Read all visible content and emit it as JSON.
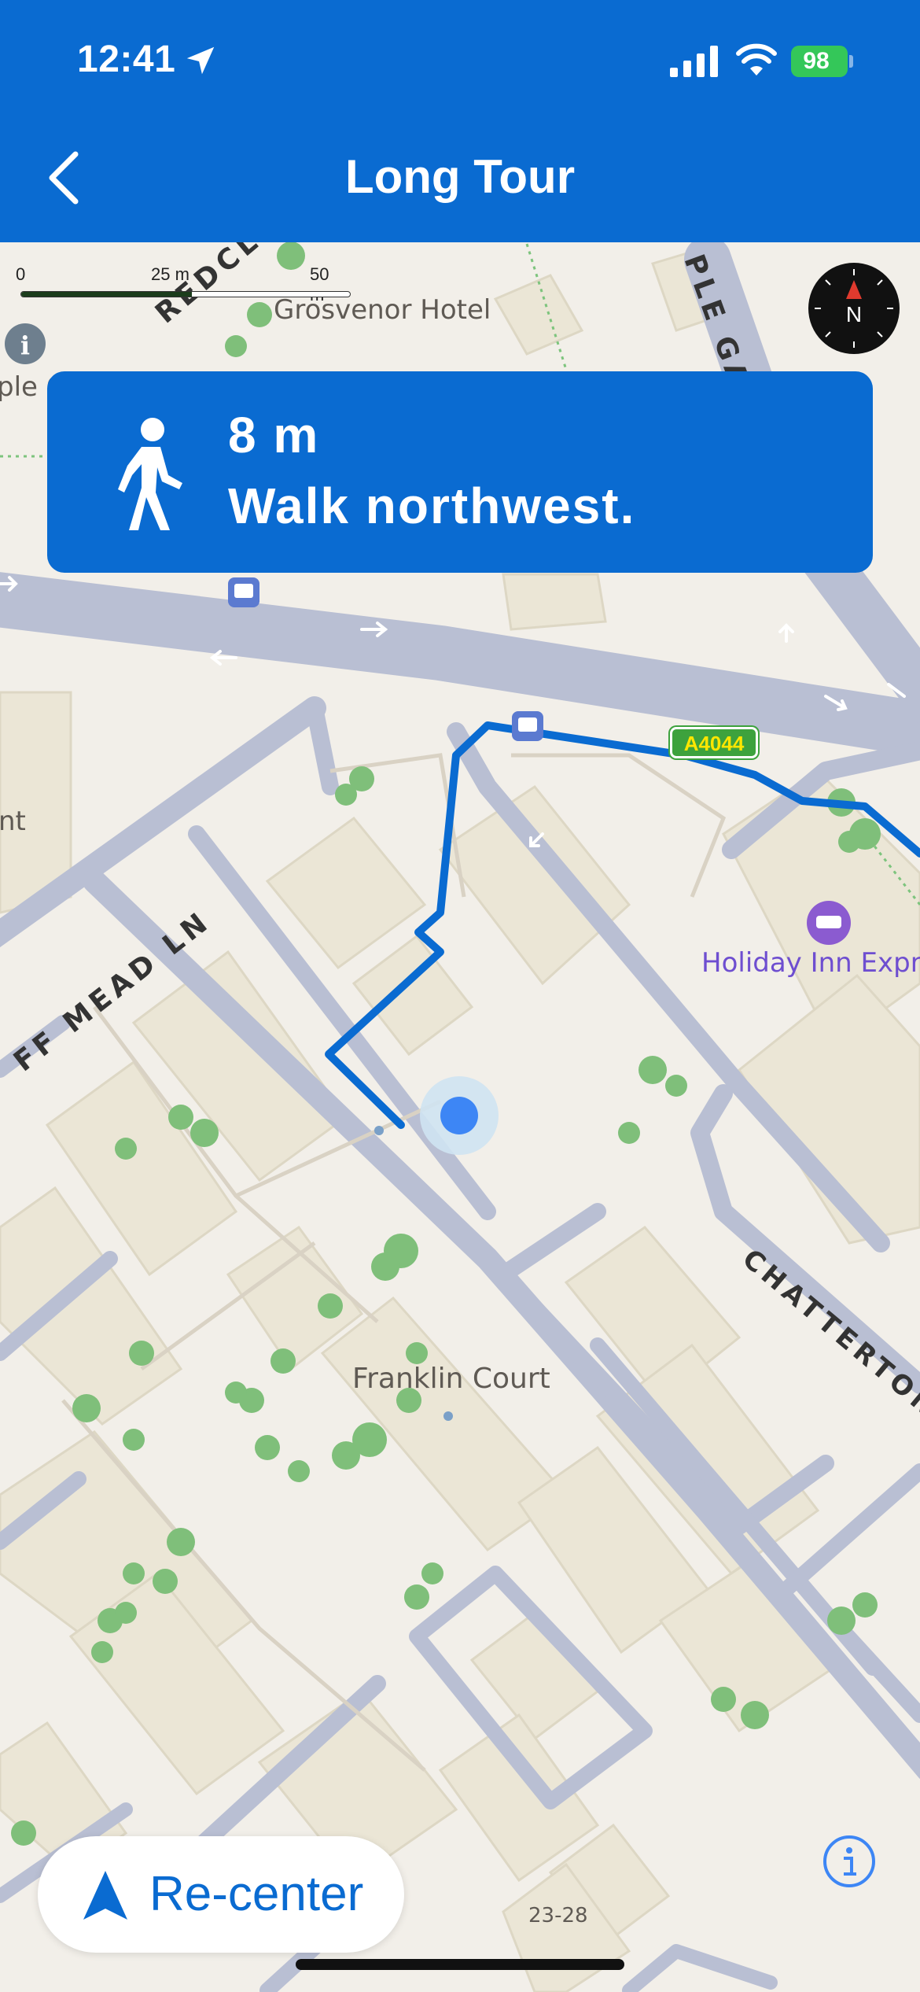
{
  "status_bar": {
    "time": "12:41",
    "battery": "98"
  },
  "header": {
    "title": "Long Tour",
    "back_icon": "chevron-left-icon"
  },
  "scale_bar": {
    "labels": [
      "0",
      "25 m",
      "50 m"
    ]
  },
  "compass": {
    "label": "N"
  },
  "navigation": {
    "distance": "8 m",
    "instruction": "Walk northwest.",
    "icon": "pedestrian-icon"
  },
  "map": {
    "place_labels": [
      "Grosvenor Hotel",
      "Holiday Inn Expre",
      "Franklin Court",
      "ple C",
      "nt",
      "23-28"
    ],
    "road_labels": [
      "REDCLI",
      "PLE GA",
      "FF MEAD LN",
      "CHATTERTON S"
    ],
    "road_shield": "A4044",
    "route_color": "#0a6bd1"
  },
  "recenter": {
    "label": "Re-center"
  },
  "colors": {
    "accent": "#0a6bd1",
    "battery": "#34c759",
    "map_bg": "#f2efe9",
    "road": "#b9bfd3",
    "building": "#ebe6d6"
  }
}
